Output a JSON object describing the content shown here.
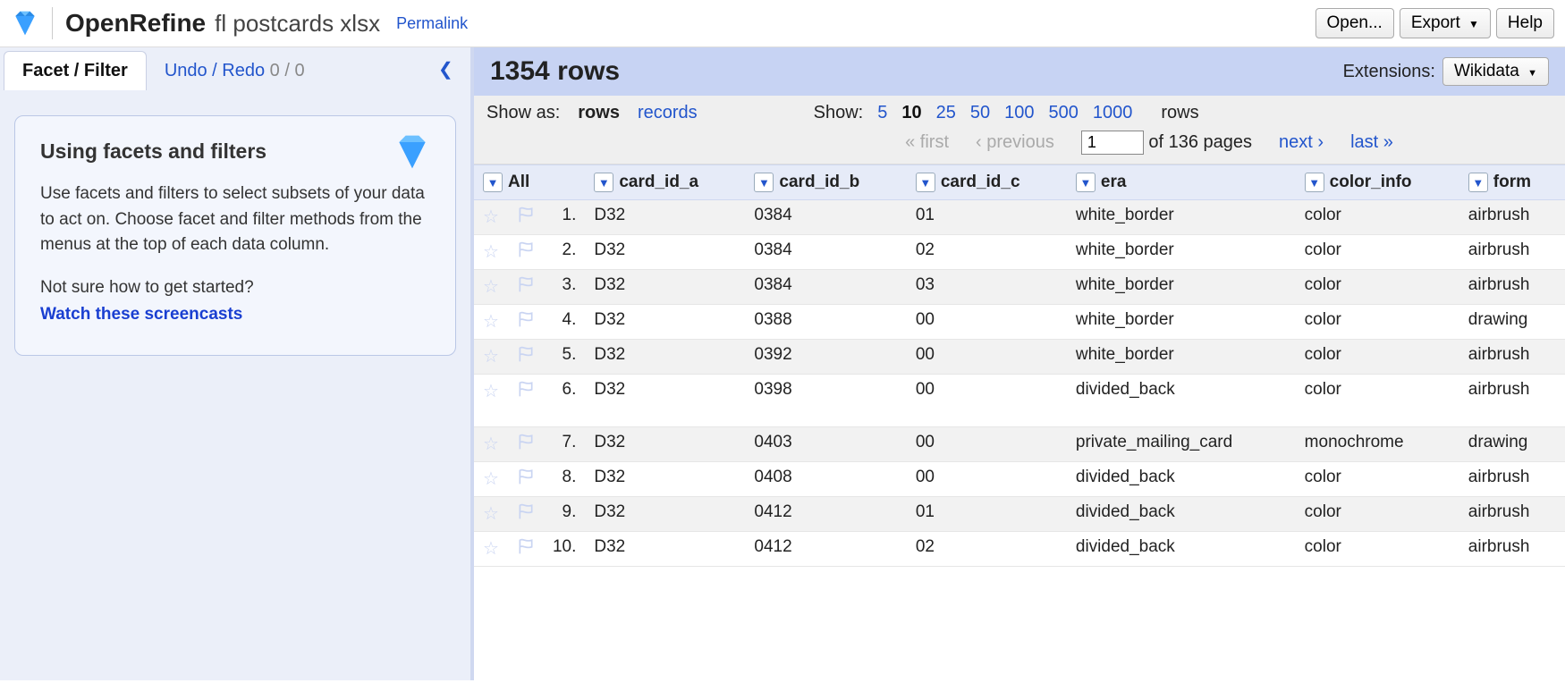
{
  "header": {
    "app_title": "OpenRefine",
    "project_name": "fl postcards xlsx",
    "permalink": "Permalink",
    "open_btn": "Open...",
    "export_btn": "Export",
    "help_btn": "Help"
  },
  "left": {
    "tab_facet": "Facet / Filter",
    "tab_undo": "Undo / Redo",
    "undo_counter": "0 / 0",
    "facet_title": "Using facets and filters",
    "facet_body_1": "Use facets and filters to select subsets of your data to act on. Choose facet and filter methods from the menus at the top of each data column.",
    "facet_body_2": "Not sure how to get started?",
    "facet_link": "Watch these screencasts"
  },
  "summary": {
    "rows_label": "1354 rows",
    "extensions_label": "Extensions:",
    "extension_btn": "Wikidata"
  },
  "toolbar": {
    "show_as_label": "Show as:",
    "show_as_rows": "rows",
    "show_as_records": "records",
    "show_label": "Show:",
    "sizes": [
      "5",
      "10",
      "25",
      "50",
      "100",
      "500",
      "1000"
    ],
    "active_size": "10",
    "rows_word": "rows",
    "first": "« first",
    "prev": "‹ previous",
    "page_value": "1",
    "of_pages": "of 136 pages",
    "next": "next ›",
    "last": "last »"
  },
  "table": {
    "all_col": "All",
    "columns": [
      "card_id_a",
      "card_id_b",
      "card_id_c",
      "era",
      "color_info",
      "form"
    ],
    "rows": [
      {
        "n": "1.",
        "card_id_a": "D32",
        "card_id_b": "0384",
        "card_id_c": "01",
        "era": "white_border",
        "color_info": "color",
        "form": "airbrush"
      },
      {
        "n": "2.",
        "card_id_a": "D32",
        "card_id_b": "0384",
        "card_id_c": "02",
        "era": "white_border",
        "color_info": "color",
        "form": "airbrush"
      },
      {
        "n": "3.",
        "card_id_a": "D32",
        "card_id_b": "0384",
        "card_id_c": "03",
        "era": "white_border",
        "color_info": "color",
        "form": "airbrush"
      },
      {
        "n": "4.",
        "card_id_a": "D32",
        "card_id_b": "0388",
        "card_id_c": "00",
        "era": "white_border",
        "color_info": "color",
        "form": "drawing"
      },
      {
        "n": "5.",
        "card_id_a": "D32",
        "card_id_b": "0392",
        "card_id_c": "00",
        "era": "white_border",
        "color_info": "color",
        "form": "airbrush"
      },
      {
        "n": "6.",
        "card_id_a": "D32",
        "card_id_b": "0398",
        "card_id_c": "00",
        "era": "divided_back",
        "color_info": "color",
        "form": "airbrush"
      },
      {
        "n": "7.",
        "card_id_a": "D32",
        "card_id_b": "0403",
        "card_id_c": "00",
        "era": "private_mailing_card",
        "color_info": "monochrome",
        "form": "drawing"
      },
      {
        "n": "8.",
        "card_id_a": "D32",
        "card_id_b": "0408",
        "card_id_c": "00",
        "era": "divided_back",
        "color_info": "color",
        "form": "airbrush"
      },
      {
        "n": "9.",
        "card_id_a": "D32",
        "card_id_b": "0412",
        "card_id_c": "01",
        "era": "divided_back",
        "color_info": "color",
        "form": "airbrush"
      },
      {
        "n": "10.",
        "card_id_a": "D32",
        "card_id_b": "0412",
        "card_id_c": "02",
        "era": "divided_back",
        "color_info": "color",
        "form": "airbrush"
      }
    ]
  }
}
